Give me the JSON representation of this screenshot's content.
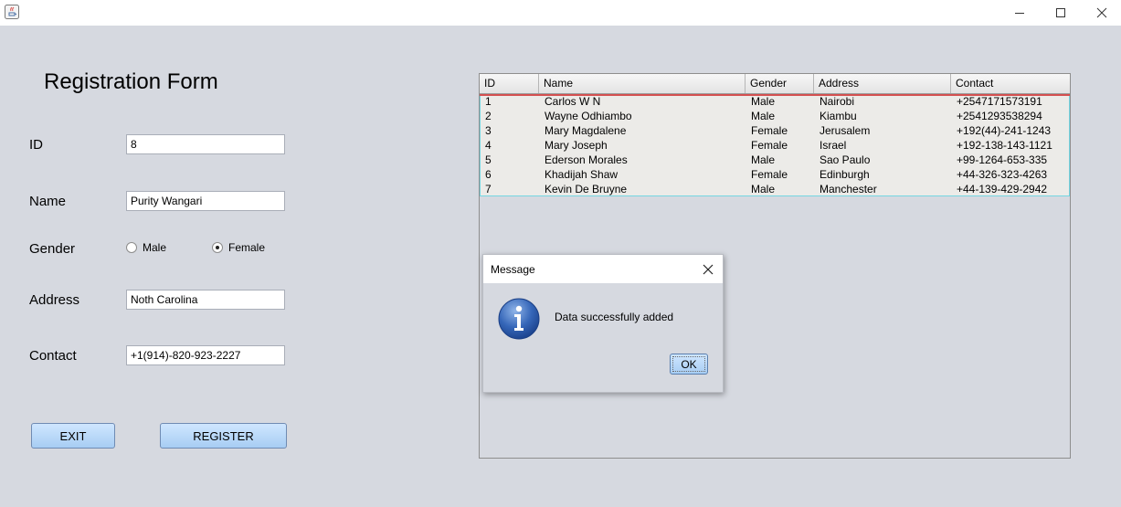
{
  "window": {
    "minimize_symbol": "—",
    "maximize_symbol": "☐",
    "close_symbol": "✕"
  },
  "form": {
    "title": "Registration Form",
    "id_label": "ID",
    "id_value": "8",
    "name_label": "Name",
    "name_value": "Purity Wangari",
    "gender_label": "Gender",
    "gender_options": [
      "Male",
      "Female"
    ],
    "gender_selected": "Female",
    "address_label": "Address",
    "address_value": "Noth Carolina",
    "contact_label": "Contact",
    "contact_value": "+1(914)-820-923-2227",
    "exit_label": "EXIT",
    "register_label": "REGISTER"
  },
  "table": {
    "columns": [
      "ID",
      "Name",
      "Gender",
      "Address",
      "Contact"
    ],
    "rows": [
      [
        "1",
        "Carlos W N",
        "Male",
        "Nairobi",
        "+2547171573191"
      ],
      [
        "2",
        "Wayne Odhiambo",
        "Male",
        "Kiambu",
        "+2541293538294"
      ],
      [
        "3",
        "Mary Magdalene",
        "Female",
        "Jerusalem",
        "+192(44)-241-1243"
      ],
      [
        "4",
        "Mary Joseph",
        "Female",
        "Israel",
        "+192-138-143-1121"
      ],
      [
        "5",
        "Ederson Morales",
        "Male",
        "Sao Paulo",
        "+99-1264-653-335"
      ],
      [
        "6",
        "Khadijah Shaw",
        "Female",
        "Edinburgh",
        "+44-326-323-4263"
      ],
      [
        "7",
        "Kevin De Bruyne",
        "Male",
        "Manchester",
        "+44-139-429-2942"
      ]
    ]
  },
  "dialog": {
    "title": "Message",
    "message": "Data successfully added",
    "ok_label": "OK",
    "icon": "info-icon"
  },
  "colors": {
    "background": "#d6d9e0",
    "button_top": "#cfe6ff",
    "button_bottom": "#a7cdf3",
    "selected_row_border": "#d45050",
    "table_focus_border": "#74d6e2",
    "info_icon_blue": "#2f5fae"
  }
}
